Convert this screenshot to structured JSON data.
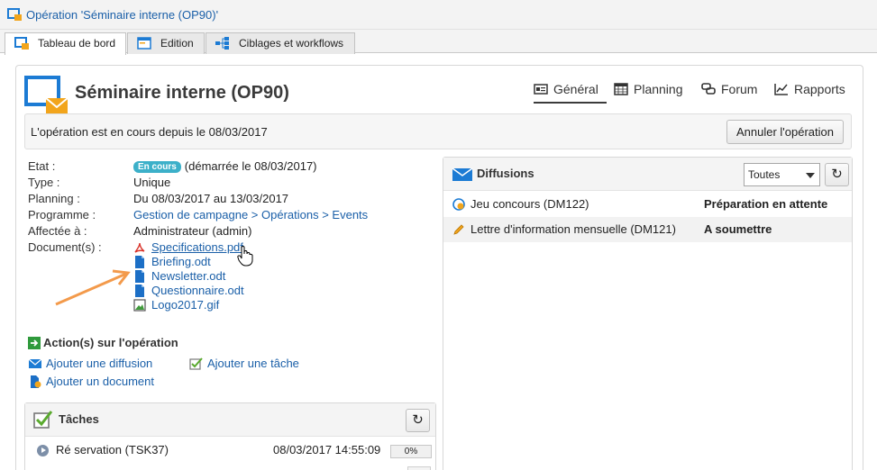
{
  "window": {
    "title": "Opération 'Séminaire interne (OP90)'"
  },
  "tabs": [
    {
      "label": "Tableau de bord",
      "icon": "dashboard-icon",
      "active": true
    },
    {
      "label": "Edition",
      "icon": "edit-form-icon",
      "active": false
    },
    {
      "label": "Ciblages et workflows",
      "icon": "workflow-icon",
      "active": false
    }
  ],
  "operation": {
    "title": "Séminaire interne (OP90)",
    "icon": "operation-envelope-icon"
  },
  "nav": [
    {
      "label": "Général",
      "icon": "general-icon",
      "active": true
    },
    {
      "label": "Planning",
      "icon": "calendar-icon",
      "active": false
    },
    {
      "label": "Forum",
      "icon": "forum-icon",
      "active": false
    },
    {
      "label": "Rapports",
      "icon": "chart-icon",
      "active": false
    }
  ],
  "status_bar": {
    "message": "L'opération est en cours depuis le 08/03/2017",
    "cancel_button": "Annuler l'opération"
  },
  "details": {
    "etat": {
      "label": "Etat :",
      "badge": "En cours",
      "value": "(démarrée le 08/03/2017)"
    },
    "type": {
      "label": "Type :",
      "value": "Unique"
    },
    "planning": {
      "label": "Planning :",
      "value": "Du 08/03/2017 au 13/03/2017"
    },
    "programme": {
      "label": "Programme :",
      "value": "Gestion de campagne > Opérations > Events"
    },
    "affectee": {
      "label": "Affectée à :",
      "value": "Administrateur (admin)"
    },
    "documents": {
      "label": "Document(s) :",
      "items": [
        {
          "name": "Specifications.pdf",
          "icon": "pdf-icon"
        },
        {
          "name": "Briefing.odt",
          "icon": "document-icon"
        },
        {
          "name": "Newsletter.odt",
          "icon": "document-icon"
        },
        {
          "name": "Questionnaire.odt",
          "icon": "document-icon"
        },
        {
          "name": "Logo2017.gif",
          "icon": "image-icon"
        }
      ]
    }
  },
  "actions": {
    "title": "Action(s) sur l'opération",
    "add_delivery": "Ajouter une diffusion",
    "add_task": "Ajouter une tâche",
    "add_document": "Ajouter un document"
  },
  "tasks": {
    "title": "Tâches",
    "rows": [
      {
        "name": "Ré servation (TSK37)",
        "date": "08/03/2017 14:55:09",
        "progress": "0%"
      }
    ]
  },
  "deliveries": {
    "title": "Diffusions",
    "filter": "Toutes",
    "rows": [
      {
        "name": "Jeu concours (DM122)",
        "status": "Préparation en attente",
        "icon": "pending-delivery-icon"
      },
      {
        "name": "Lettre d'information mensuelle (DM121)",
        "status": "A soumettre",
        "icon": "pencil-icon"
      }
    ]
  },
  "colors": {
    "link": "#1a5fa8",
    "accent_blue": "#1c7bd4",
    "envelope_orange": "#f2a51c",
    "badge": "#3cb0c9",
    "annotation_arrow": "#f39a4b"
  }
}
